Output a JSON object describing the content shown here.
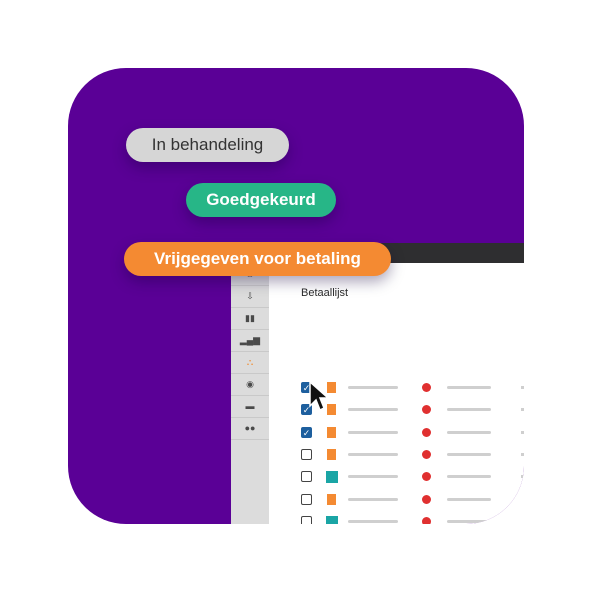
{
  "pills": {
    "pending": "In behandeling",
    "approved": "Goedgekeurd",
    "released": "Vrijgegeven voor betaling"
  },
  "app": {
    "title": "Betaallijst",
    "sidebar_icons": [
      "home-icon",
      "download-icon",
      "book-icon",
      "bar-chart-icon",
      "bank-icon",
      "handshake-icon",
      "truck-icon",
      "users-icon"
    ],
    "active_sidebar_icon": "bank-icon",
    "rows": [
      {
        "checked": true,
        "doc": "orange"
      },
      {
        "checked": true,
        "doc": "orange"
      },
      {
        "checked": true,
        "doc": "orange"
      },
      {
        "checked": false,
        "doc": "orange"
      },
      {
        "checked": false,
        "doc": "teal"
      },
      {
        "checked": false,
        "doc": "orange"
      },
      {
        "checked": false,
        "doc": "teal"
      },
      {
        "checked": false,
        "doc": "teal"
      },
      {
        "checked": false,
        "doc": "orange"
      },
      {
        "checked": false,
        "doc": "orange"
      }
    ]
  },
  "colors": {
    "background": "#5a0096",
    "accent_orange": "#f48a32",
    "accent_green": "#27b687",
    "checkbox_blue": "#1d5f9e",
    "status_red": "#e03030",
    "doc_teal": "#1aa5a5"
  }
}
